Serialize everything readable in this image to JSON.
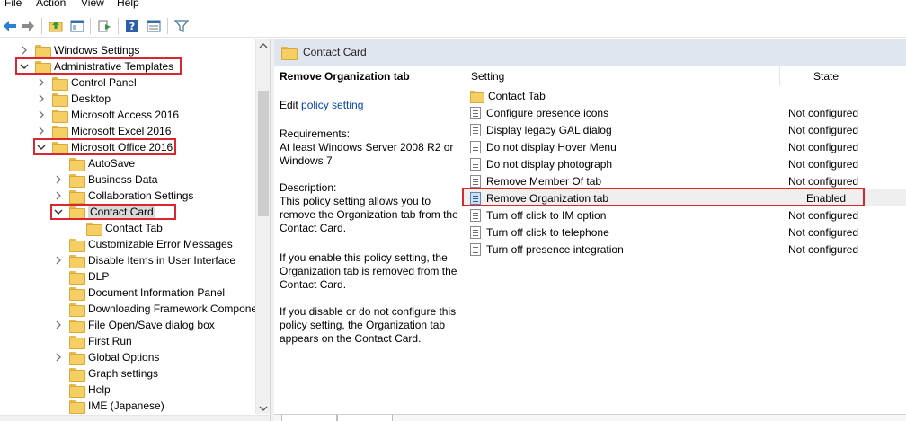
{
  "menu": {
    "file": "File",
    "action": "Action",
    "view": "View",
    "help": "Help"
  },
  "toolbar": {
    "icons": [
      "back-arrow-icon",
      "forward-arrow-icon",
      "up-folder-icon",
      "show-hide-tree-icon",
      "export-list-icon",
      "help-icon",
      "properties-icon",
      "filter-icon"
    ]
  },
  "tree": {
    "items": [
      {
        "label": "Windows Settings",
        "level": 1,
        "expander": "collapsed"
      },
      {
        "label": "Administrative Templates",
        "level": 1,
        "expander": "expanded"
      },
      {
        "label": "Control Panel",
        "level": 2,
        "expander": "collapsed"
      },
      {
        "label": "Desktop",
        "level": 2,
        "expander": "collapsed"
      },
      {
        "label": "Microsoft Access 2016",
        "level": 2,
        "expander": "collapsed"
      },
      {
        "label": "Microsoft Excel 2016",
        "level": 2,
        "expander": "collapsed"
      },
      {
        "label": "Microsoft Office 2016",
        "level": 2,
        "expander": "expanded"
      },
      {
        "label": "AutoSave",
        "level": 3,
        "expander": "none"
      },
      {
        "label": "Business Data",
        "level": 3,
        "expander": "collapsed"
      },
      {
        "label": "Collaboration Settings",
        "level": 3,
        "expander": "collapsed"
      },
      {
        "label": "Contact Card",
        "level": 3,
        "expander": "expanded",
        "selected": true
      },
      {
        "label": "Contact Tab",
        "level": 4,
        "expander": "none"
      },
      {
        "label": "Customizable Error Messages",
        "level": 3,
        "expander": "none"
      },
      {
        "label": "Disable Items in User Interface",
        "level": 3,
        "expander": "collapsed"
      },
      {
        "label": "DLP",
        "level": 3,
        "expander": "none"
      },
      {
        "label": "Document Information Panel",
        "level": 3,
        "expander": "none"
      },
      {
        "label": "Downloading Framework Compone",
        "level": 3,
        "expander": "none"
      },
      {
        "label": "File Open/Save dialog box",
        "level": 3,
        "expander": "collapsed"
      },
      {
        "label": "First Run",
        "level": 3,
        "expander": "none"
      },
      {
        "label": "Global Options",
        "level": 3,
        "expander": "collapsed"
      },
      {
        "label": "Graph settings",
        "level": 3,
        "expander": "none"
      },
      {
        "label": "Help",
        "level": 3,
        "expander": "none"
      },
      {
        "label": "IME (Japanese)",
        "level": 3,
        "expander": "none"
      }
    ]
  },
  "right": {
    "header_title": "Contact Card",
    "description": {
      "heading": "Remove Organization tab",
      "edit_prefix": "Edit",
      "edit_link": "policy setting",
      "requirements": "Requirements:\nAt least Windows Server 2008 R2 or Windows 7",
      "description": "Description:\nThis policy setting allows you to remove the Organization tab from the Contact Card.",
      "if_enabled": "If you enable this policy setting, the Organization tab is removed from the Contact Card.",
      "if_disabled": "If you disable or do not configure this policy setting, the Organization tab appears on the Contact Card."
    },
    "list": {
      "col_setting": "Setting",
      "col_state": "State",
      "rows": [
        {
          "name": "Contact Tab",
          "state": "",
          "type": "folder"
        },
        {
          "name": "Configure presence icons",
          "state": "Not configured",
          "type": "policy"
        },
        {
          "name": "Display legacy GAL dialog",
          "state": "Not configured",
          "type": "policy"
        },
        {
          "name": "Do not display Hover Menu",
          "state": "Not configured",
          "type": "policy"
        },
        {
          "name": "Do not display photograph",
          "state": "Not configured",
          "type": "policy"
        },
        {
          "name": "Remove Member Of tab",
          "state": "Not configured",
          "type": "policy"
        },
        {
          "name": "Remove Organization tab",
          "state": "Enabled",
          "type": "policy",
          "selected": true
        },
        {
          "name": "Turn off click to IM option",
          "state": "Not configured",
          "type": "policy"
        },
        {
          "name": "Turn off click to telephone",
          "state": "Not configured",
          "type": "policy"
        },
        {
          "name": "Turn off presence integration",
          "state": "Not configured",
          "type": "policy"
        }
      ]
    }
  },
  "colors": {
    "highlight_box": "#d9262f",
    "header_bg": "#dfe6ef",
    "link": "#0645ad"
  }
}
